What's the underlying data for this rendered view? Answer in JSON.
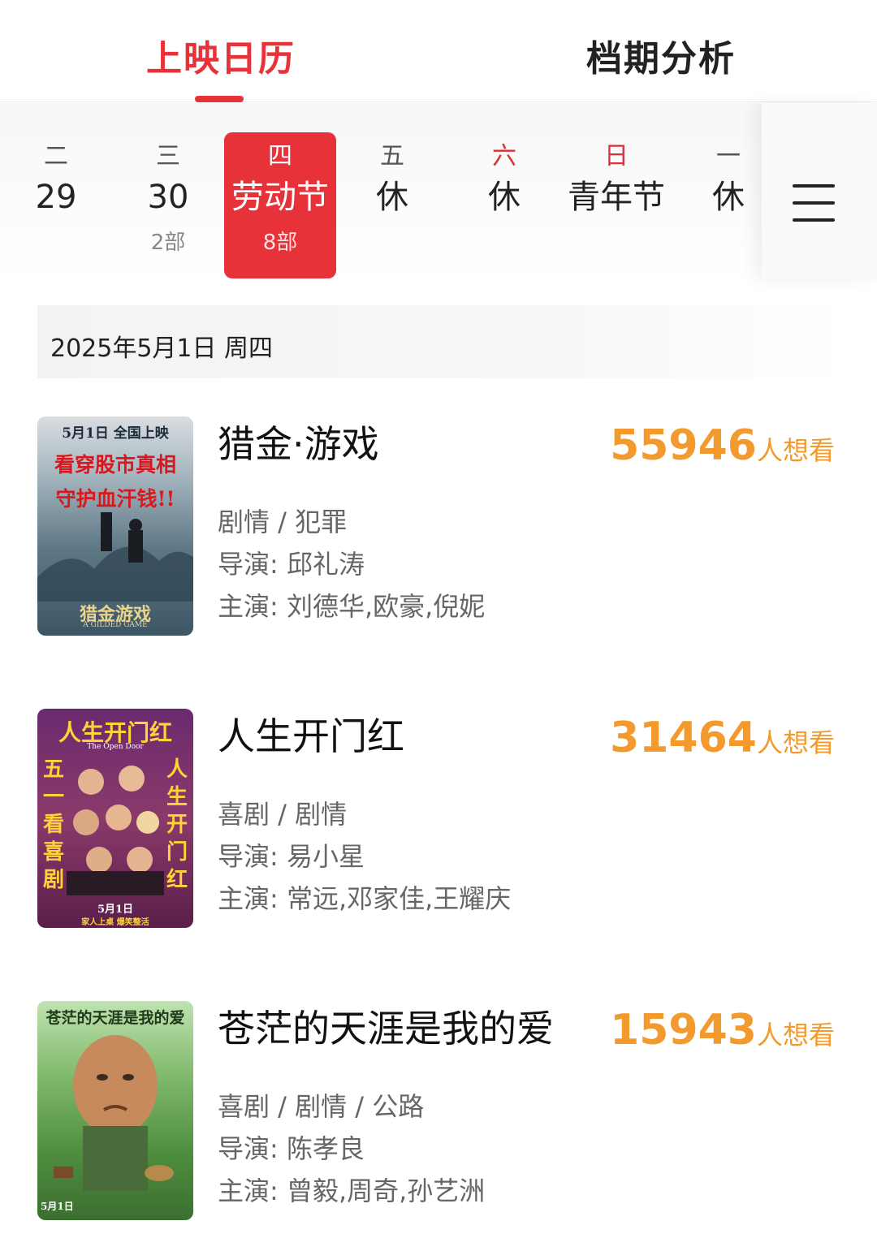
{
  "tabs": {
    "calendar": "上映日历",
    "analysis": "档期分析"
  },
  "days": [
    {
      "weekday": "二",
      "label": "29",
      "count": ""
    },
    {
      "weekday": "三",
      "label": "30",
      "count": "2部"
    },
    {
      "weekday": "四",
      "label": "劳动节",
      "count": "8部"
    },
    {
      "weekday": "五",
      "label": "休",
      "count": ""
    },
    {
      "weekday": "六",
      "label": "休",
      "count": ""
    },
    {
      "weekday": "日",
      "label": "青年节",
      "count": ""
    },
    {
      "weekday": "一",
      "label": "休",
      "count": ""
    }
  ],
  "selected_date": "2025年5月1日  周四",
  "menu_icon": "hamburger-menu-icon",
  "colors": {
    "accent": "#e8323a",
    "want": "#f29a2e"
  },
  "movies": [
    {
      "title": "猎金·游戏",
      "want_count": "55946",
      "want_label": "人想看",
      "genre": "剧情 / 犯罪",
      "director": "导演: 邱礼涛",
      "cast": "主演: 刘德华,欧豪,倪妮",
      "poster_text": {
        "top": "5月1日 全国上映",
        "line1": "看穿股市真相",
        "line2": "守护血汗钱!!",
        "name": "猎金游戏",
        "sub": "A GILDED GAME"
      }
    },
    {
      "title": "人生开门红",
      "want_count": "31464",
      "want_label": "人想看",
      "genre": "喜剧 / 剧情",
      "director": "导演: 易小星",
      "cast": "主演: 常远,邓家佳,王耀庆",
      "poster_text": {
        "top": "人生开门红",
        "sub": "The Open Door",
        "left": "五一看喜剧",
        "right": "人生开门红",
        "date": "5月1日",
        "tag": "家人上桌 爆笑整活"
      }
    },
    {
      "title": "苍茫的天涯是我的爱",
      "want_count": "15943",
      "want_label": "人想看",
      "genre": "喜剧 / 剧情 / 公路",
      "director": "导演: 陈孝良",
      "cast": "主演: 曾毅,周奇,孙艺洲",
      "poster_text": {
        "top": "苍茫的天涯是我的爱",
        "date": "5月1日"
      }
    }
  ]
}
